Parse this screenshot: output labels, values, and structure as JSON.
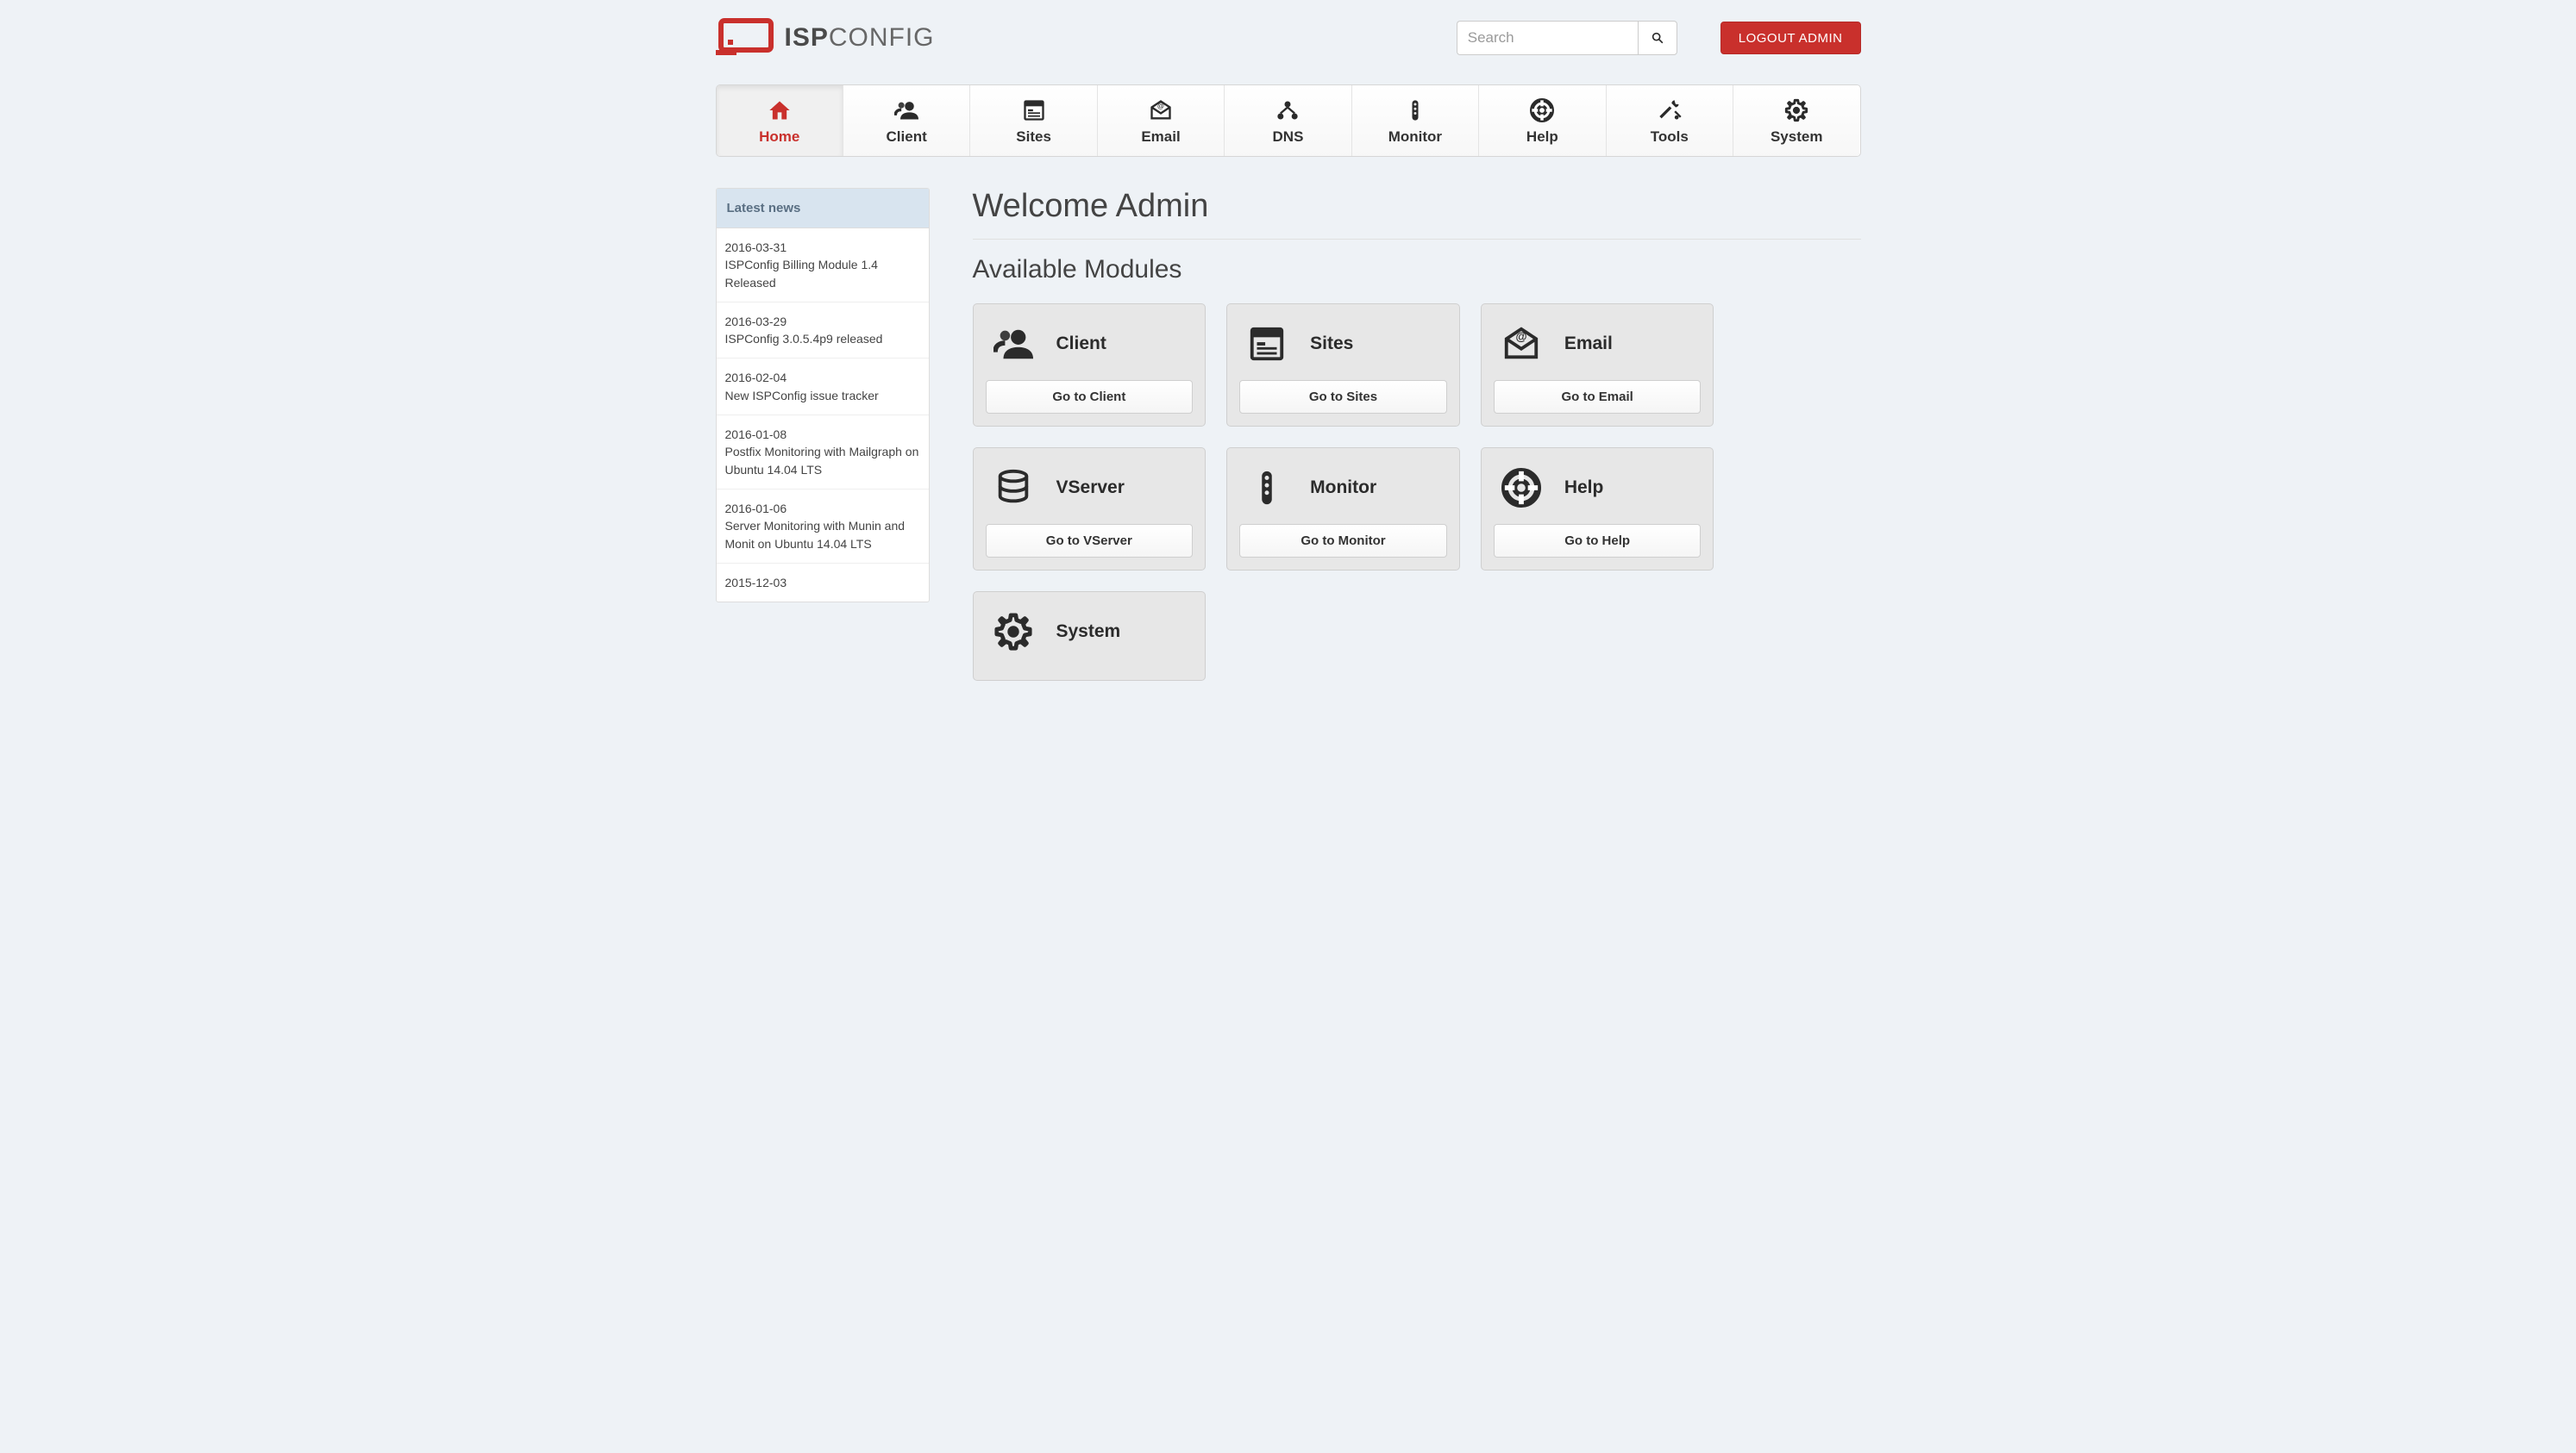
{
  "brand": {
    "bold": "ISP",
    "light": "CONFIG"
  },
  "header": {
    "search_placeholder": "Search",
    "logout_label": "LOGOUT ADMIN"
  },
  "nav": [
    {
      "id": "home",
      "label": "Home",
      "icon": "home",
      "active": true
    },
    {
      "id": "client",
      "label": "Client",
      "icon": "client",
      "active": false
    },
    {
      "id": "sites",
      "label": "Sites",
      "icon": "sites",
      "active": false
    },
    {
      "id": "email",
      "label": "Email",
      "icon": "email",
      "active": false
    },
    {
      "id": "dns",
      "label": "DNS",
      "icon": "dns",
      "active": false
    },
    {
      "id": "monitor",
      "label": "Monitor",
      "icon": "monitor",
      "active": false
    },
    {
      "id": "help",
      "label": "Help",
      "icon": "help",
      "active": false
    },
    {
      "id": "tools",
      "label": "Tools",
      "icon": "tools",
      "active": false
    },
    {
      "id": "system",
      "label": "System",
      "icon": "system",
      "active": false
    }
  ],
  "sidebar": {
    "news_header": "Latest news",
    "news": [
      {
        "date": "2016-03-31",
        "title": "ISPConfig Billing Module 1.4 Released"
      },
      {
        "date": "2016-03-29",
        "title": "ISPConfig 3.0.5.4p9 released"
      },
      {
        "date": "2016-02-04",
        "title": "New ISPConfig issue tracker"
      },
      {
        "date": "2016-01-08",
        "title": "Postfix Monitoring with Mailgraph on Ubuntu 14.04 LTS"
      },
      {
        "date": "2016-01-06",
        "title": "Server Monitoring with Munin and Monit on Ubuntu 14.04 LTS"
      },
      {
        "date": "2015-12-03",
        "title": ""
      }
    ]
  },
  "main": {
    "title": "Welcome Admin",
    "subtitle": "Available Modules",
    "modules": [
      {
        "id": "client",
        "title": "Client",
        "button": "Go to Client",
        "icon": "client"
      },
      {
        "id": "sites",
        "title": "Sites",
        "button": "Go to Sites",
        "icon": "sites"
      },
      {
        "id": "email",
        "title": "Email",
        "button": "Go to Email",
        "icon": "email"
      },
      {
        "id": "vserver",
        "title": "VServer",
        "button": "Go to VServer",
        "icon": "vserver"
      },
      {
        "id": "monitor",
        "title": "Monitor",
        "button": "Go to Monitor",
        "icon": "monitor"
      },
      {
        "id": "help",
        "title": "Help",
        "button": "Go to Help",
        "icon": "help"
      },
      {
        "id": "system",
        "title": "System",
        "button": "",
        "icon": "system"
      }
    ]
  }
}
